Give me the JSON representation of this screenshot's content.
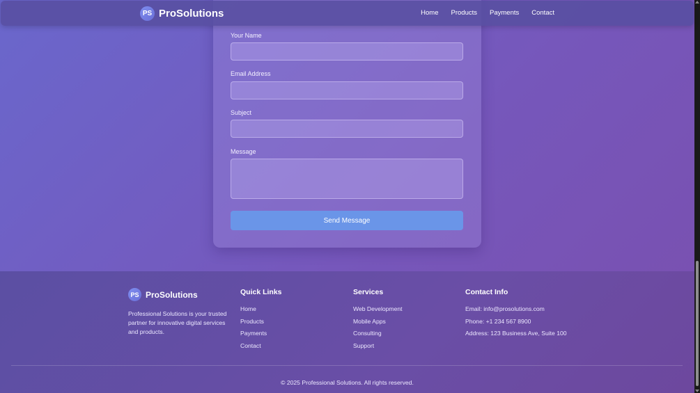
{
  "header": {
    "logo_initials": "PS",
    "brand": "ProSolutions",
    "nav": [
      "Home",
      "Products",
      "Payments",
      "Contact"
    ]
  },
  "form": {
    "name_label": "Your Name",
    "email_label": "Email Address",
    "subject_label": "Subject",
    "message_label": "Message",
    "send_label": "Send Message"
  },
  "footer": {
    "logo_initials": "PS",
    "brand": "ProSolutions",
    "description": "Professional Solutions is your trusted partner for innovative digital services and products.",
    "quick_links_title": "Quick Links",
    "quick_links": [
      "Home",
      "Products",
      "Payments",
      "Contact"
    ],
    "services_title": "Services",
    "services": [
      "Web Development",
      "Mobile Apps",
      "Consulting",
      "Support"
    ],
    "contact_title": "Contact Info",
    "contact": [
      "Email: info@prosolutions.com",
      "Phone: +1 234 567 8900",
      "Address: 123 Business Ave, Suite 100"
    ],
    "copyright": "© 2025 Professional Solutions. All rights reserved."
  },
  "colors": {
    "accent_button": "#6a95e8",
    "background_start": "#6a67cc",
    "background_end": "#7a4fae"
  }
}
